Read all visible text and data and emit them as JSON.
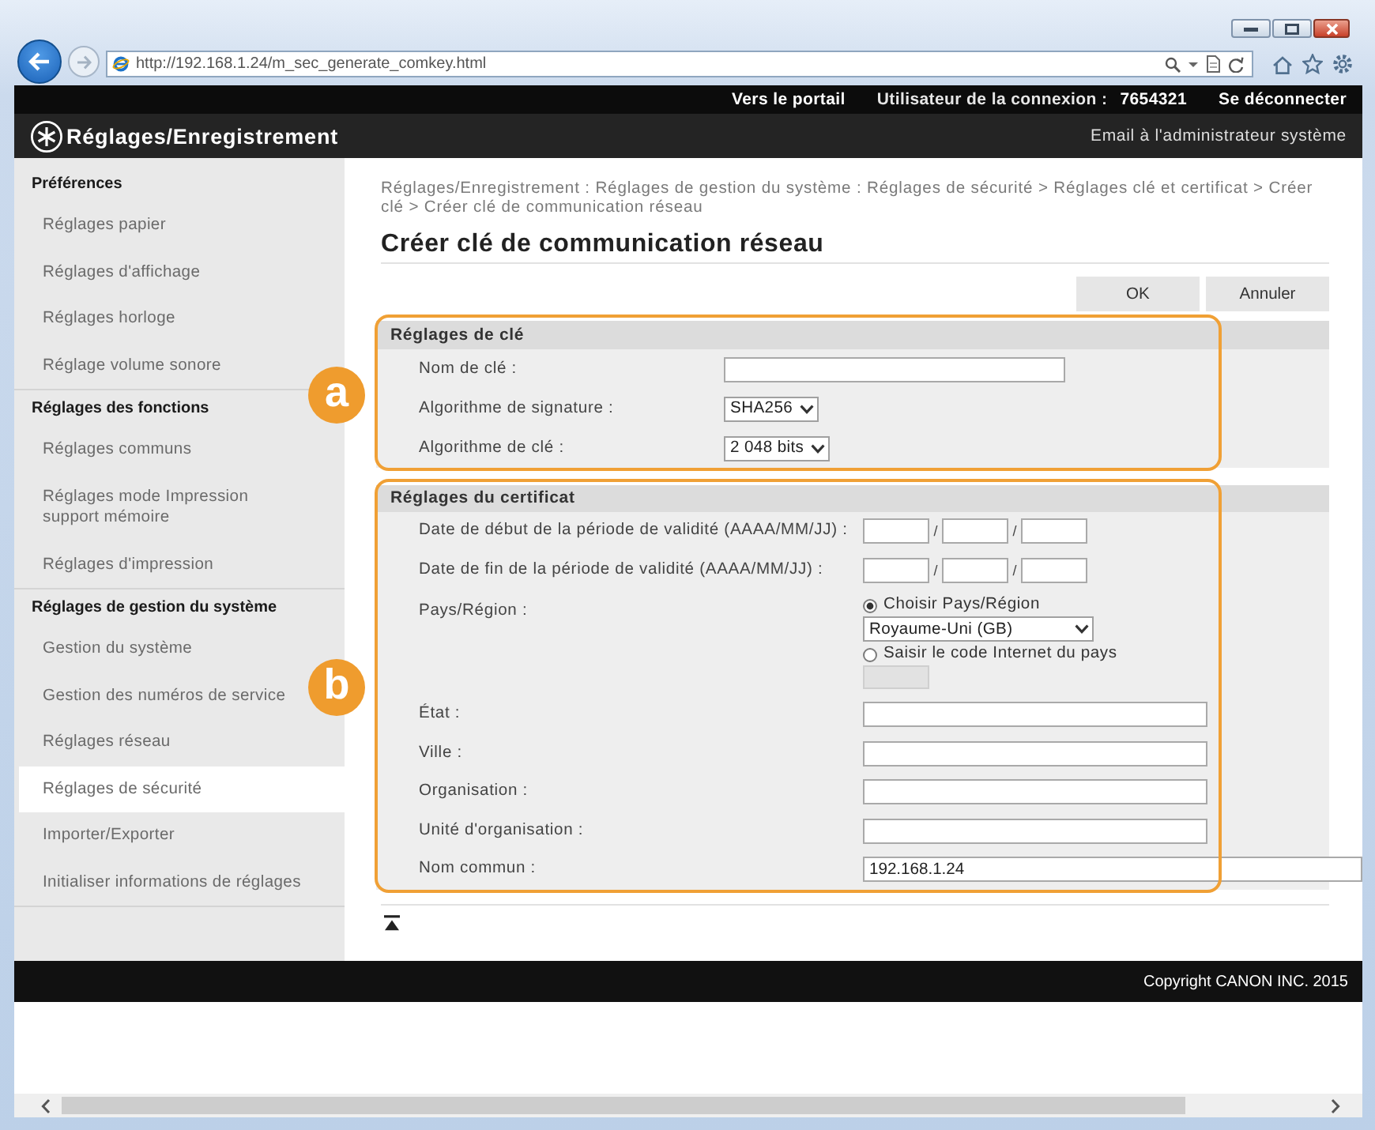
{
  "browser": {
    "address": "http://192.168.1.24/m_sec_generate_comkey.html"
  },
  "top_bar": {
    "portal_link": "Vers le portail",
    "user_label": "Utilisateur de la connexion :",
    "user_id": "7654321",
    "logout_link": "Se déconnecter"
  },
  "header": {
    "title": "Réglages/Enregistrement",
    "email_link": "Email à l'administrateur système"
  },
  "sidebar": {
    "groups": [
      {
        "heading": "Préférences",
        "items": [
          {
            "label": "Réglages papier",
            "selected": false
          },
          {
            "label": "Réglages d'affichage",
            "selected": false
          },
          {
            "label": "Réglages horloge",
            "selected": false
          },
          {
            "label": "Réglage volume sonore",
            "selected": false
          }
        ]
      },
      {
        "heading": "Réglages des fonctions",
        "items": [
          {
            "label": "Réglages communs",
            "selected": false
          },
          {
            "label": "Réglages mode Impression support mémoire",
            "selected": false
          },
          {
            "label": "Réglages d'impression",
            "selected": false
          }
        ]
      },
      {
        "heading": "Réglages de gestion du système",
        "items": [
          {
            "label": "Gestion du système",
            "selected": false
          },
          {
            "label": "Gestion des numéros de service",
            "selected": false
          },
          {
            "label": "Réglages réseau",
            "selected": false
          },
          {
            "label": "Réglages de sécurité",
            "selected": true
          },
          {
            "label": "Importer/Exporter",
            "selected": false
          },
          {
            "label": "Initialiser informations de réglages",
            "selected": false
          }
        ]
      }
    ]
  },
  "main": {
    "breadcrumb": "Réglages/Enregistrement : Réglages de gestion du système : Réglages de sécurité > Réglages clé et certificat > Créer clé > Créer clé de communication réseau",
    "title": "Créer clé de communication réseau",
    "buttons": [
      "OK",
      "Annuler"
    ],
    "sections": [
      {
        "callout": "a",
        "heading": "Réglages de clé",
        "rows": [
          {
            "kind": "text",
            "label": "Nom de clé :"
          },
          {
            "kind": "select",
            "label": "Algorithme de signature :",
            "value": "SHA256"
          },
          {
            "kind": "select",
            "label": "Algorithme de clé :",
            "value": "2 048 bits"
          }
        ]
      },
      {
        "callout": "b",
        "heading": "Réglages du certificat",
        "rows": [
          {
            "kind": "date",
            "label": "Date de début de la période de validité (AAAA/MM/JJ) :",
            "separators": [
              "/",
              "/"
            ]
          },
          {
            "kind": "date",
            "label": "Date de fin de la période de validité (AAAA/MM/JJ) :",
            "separators": [
              "/",
              "/"
            ]
          },
          {
            "kind": "country",
            "label": "Pays/Région :",
            "options": [
              {
                "label": "Choisir Pays/Région",
                "selected": true
              },
              {
                "label": "Saisir le code Internet du pays",
                "selected": false
              }
            ],
            "country": "Royaume-Uni (GB)",
            "code_disabled": true
          },
          {
            "kind": "text",
            "label": "État :"
          },
          {
            "kind": "text",
            "label": "Ville :"
          },
          {
            "kind": "text",
            "label": "Organisation :"
          },
          {
            "kind": "text",
            "label": "Unité d'organisation :"
          },
          {
            "kind": "text",
            "label": "Nom commun :",
            "value": "192.168.1.24"
          }
        ]
      }
    ]
  },
  "footer": {
    "copyright": "Copyright CANON INC. 2015"
  }
}
